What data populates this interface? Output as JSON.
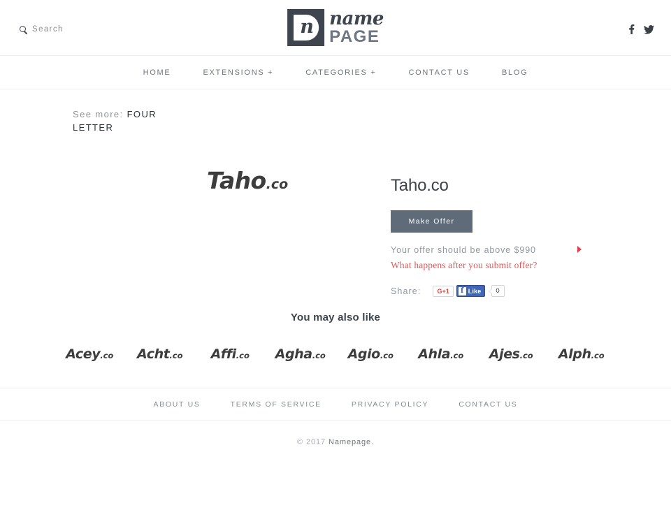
{
  "header": {
    "search": {
      "label": "Search",
      "icon": "search-icon"
    },
    "logo": {
      "mark_letter": "n",
      "name": "name",
      "page": "PAGE"
    },
    "socials": [
      {
        "name": "facebook-icon",
        "glyph": "f"
      },
      {
        "name": "twitter-icon",
        "glyph": "twitter-bird"
      }
    ]
  },
  "nav": {
    "items": [
      {
        "label": "HOME"
      },
      {
        "label": "EXTENSIONS +"
      },
      {
        "label": "CATEGORIES +"
      },
      {
        "label": "CONTACT US"
      },
      {
        "label": "BLOG"
      }
    ]
  },
  "see_more": {
    "label": "See more:",
    "link": "FOUR LETTER"
  },
  "listing": {
    "art_name": "Taho",
    "art_tld": ".co",
    "title": "Taho.co",
    "offer_button": "Make Offer",
    "offer_note": "Your offer should be above $990",
    "minimum_price": "$990",
    "help_link": "What happens after you submit offer?",
    "share_label": "Share:",
    "gplus_label": "G+1",
    "facebook_label": "Like",
    "facebook_count": "0"
  },
  "also_like": {
    "title": "You may also like",
    "items": [
      {
        "name": "Acey",
        "tld": ".co"
      },
      {
        "name": "Acht",
        "tld": ".co"
      },
      {
        "name": "Affi",
        "tld": ".co"
      },
      {
        "name": "Agha",
        "tld": ".co"
      },
      {
        "name": "Agio",
        "tld": ".co"
      },
      {
        "name": "Ahla",
        "tld": ".co"
      },
      {
        "name": "Ajes",
        "tld": ".co"
      },
      {
        "name": "Alph",
        "tld": ".co"
      }
    ]
  },
  "footer": {
    "links": [
      {
        "label": "ABOUT US"
      },
      {
        "label": "TERMS OF SERVICE"
      },
      {
        "label": "PRIVACY POLICY"
      },
      {
        "label": "CONTACT US"
      }
    ],
    "copyright_prefix": "© 2017",
    "copyright_brand": "Namepage."
  },
  "colors": {
    "accent_button": "#5f6b78",
    "help_link": "#e05a5a",
    "logo_dark": "#3f454e",
    "facebook_blue": "#4267b2",
    "gplus_red": "#d9483b"
  }
}
